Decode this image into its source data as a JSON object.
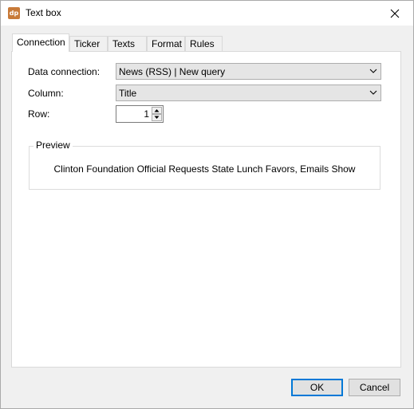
{
  "window": {
    "title": "Text box",
    "app_icon_text": "dp"
  },
  "tabs": [
    {
      "label": "Connection",
      "active": true
    },
    {
      "label": "Ticker",
      "active": false
    },
    {
      "label": "Texts",
      "active": false
    },
    {
      "label": "Format",
      "active": false
    },
    {
      "label": "Rules",
      "active": false
    }
  ],
  "connection": {
    "data_connection_label": "Data connection:",
    "data_connection_value": "News (RSS) | New query",
    "column_label": "Column:",
    "column_value": "Title",
    "row_label": "Row:",
    "row_value": "1"
  },
  "preview": {
    "title": "Preview",
    "text": "Clinton Foundation Official Requests State Lunch Favors, Emails Show"
  },
  "buttons": {
    "ok": "OK",
    "cancel": "Cancel"
  },
  "colors": {
    "app_icon": "#c87a38",
    "default_button_border": "#0078d7"
  }
}
